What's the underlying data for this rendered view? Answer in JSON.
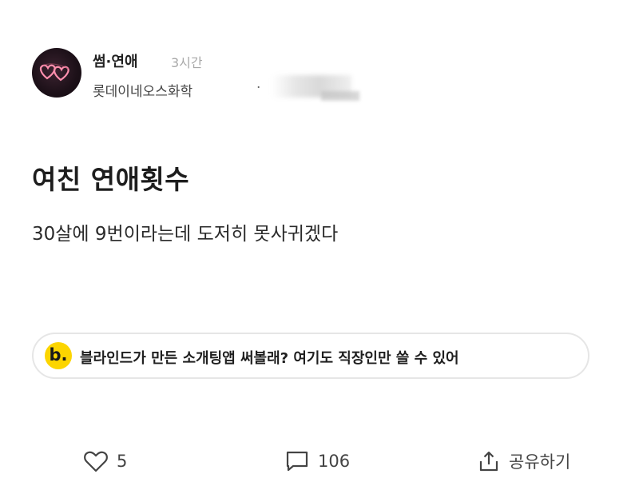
{
  "post": {
    "board": "썸·연애",
    "time": "3시간",
    "company": "롯데이네오스화학",
    "separator": "·",
    "title": "여친 연애횟수",
    "body": "30살에 9번이라는데 도저히 못사귀겠다"
  },
  "ad": {
    "logo": "b.",
    "text": "블라인드가 만든 소개팅앱 써볼래? 여기도 직장인만 쓸 수 있어"
  },
  "actions": {
    "likes": "5",
    "comments": "106",
    "share": "공유하기"
  },
  "icons": {
    "avatar": "neon-hearts-icon",
    "like": "heart-icon",
    "comment": "comment-icon",
    "share": "share-icon"
  },
  "colors": {
    "accent": "#fcd500",
    "avatar_neon": "#ff7a9c"
  }
}
